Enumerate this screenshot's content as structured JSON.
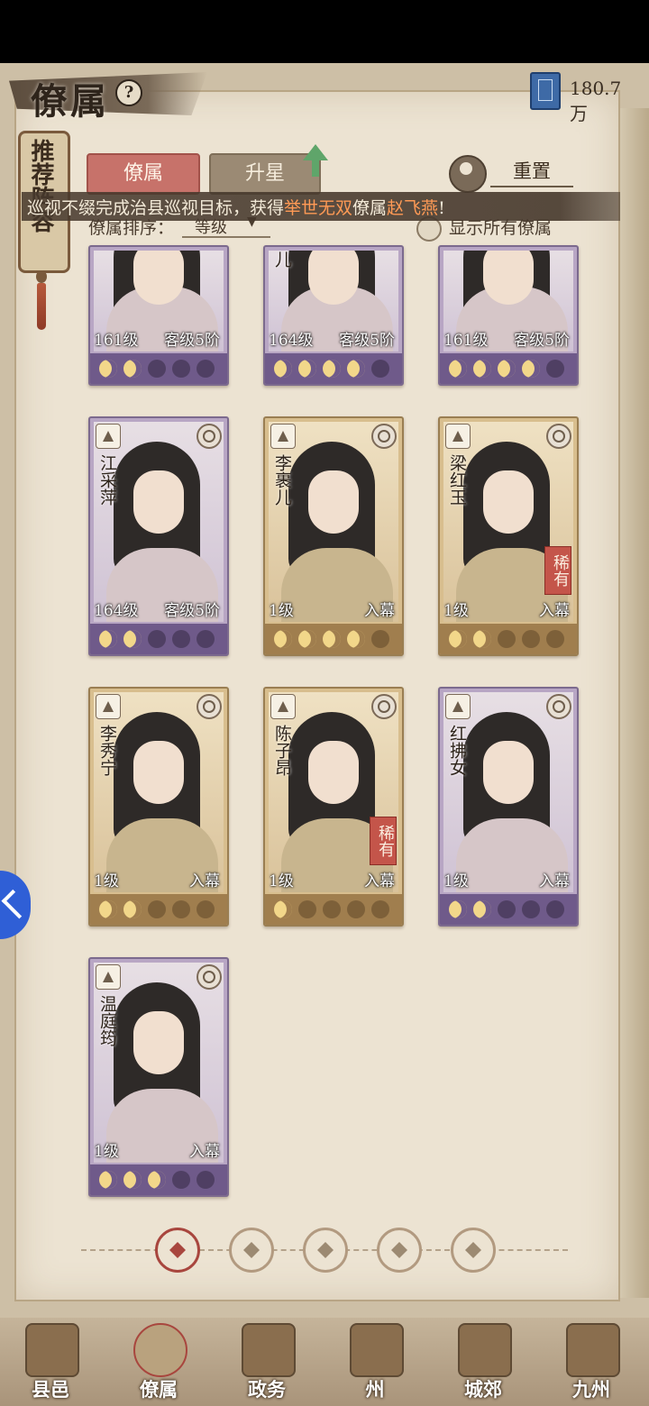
{
  "header": {
    "title": "僚属",
    "currency": "180.7万"
  },
  "side_tab": {
    "label": "推荐阵容"
  },
  "tabs": [
    {
      "label": "僚属"
    },
    {
      "label": "升星"
    }
  ],
  "reset": {
    "label": "重置"
  },
  "announcement": {
    "prefix": "巡视不缀完成治县巡视目标，获得",
    "highlight1": "举世无双",
    "mid": "僚属",
    "highlight2": "赵飞燕",
    "suffix": "!"
  },
  "sort": {
    "label": "僚属排序：",
    "value": "等级"
  },
  "show_all": {
    "label": "显示所有僚属"
  },
  "cards_top": [
    {
      "level": "161级",
      "rank": "客级5阶",
      "stars": 2,
      "color": "purple"
    },
    {
      "level": "164级",
      "rank": "客级5阶",
      "stars": 4,
      "color": "purple",
      "name_tail": "儿"
    },
    {
      "level": "161级",
      "rank": "客级5阶",
      "stars": 4,
      "color": "purple"
    }
  ],
  "cards": [
    {
      "name": "江采萍",
      "level": "164级",
      "rank": "客级5阶",
      "stars": 2,
      "color": "purple",
      "rare": ""
    },
    {
      "name": "李裹儿",
      "level": "1级",
      "rank": "入幕",
      "stars": 4,
      "color": "gold",
      "rare": ""
    },
    {
      "name": "梁红玉",
      "level": "1级",
      "rank": "入幕",
      "stars": 2,
      "color": "gold",
      "rare": "稀有"
    },
    {
      "name": "李秀宁",
      "level": "1级",
      "rank": "入幕",
      "stars": 2,
      "color": "gold",
      "rare": ""
    },
    {
      "name": "陈子昂",
      "level": "1级",
      "rank": "入幕",
      "stars": 1,
      "color": "gold",
      "rare": "稀有"
    },
    {
      "name": "红拂女",
      "level": "1级",
      "rank": "入幕",
      "stars": 2,
      "color": "purple",
      "rare": ""
    },
    {
      "name": "温庭筠",
      "level": "1级",
      "rank": "入幕",
      "stars": 3,
      "color": "purple",
      "rare": ""
    }
  ],
  "filters": [
    {
      "icon": "all-filter-icon",
      "active": true
    },
    {
      "icon": "faction-a-icon"
    },
    {
      "icon": "faction-b-icon"
    },
    {
      "icon": "faction-c-icon"
    },
    {
      "icon": "faction-d-icon"
    }
  ],
  "nav": [
    {
      "label": "县邑"
    },
    {
      "label": "僚属"
    },
    {
      "label": "政务"
    },
    {
      "label": "州"
    },
    {
      "label": "城郊"
    },
    {
      "label": "九州"
    }
  ]
}
